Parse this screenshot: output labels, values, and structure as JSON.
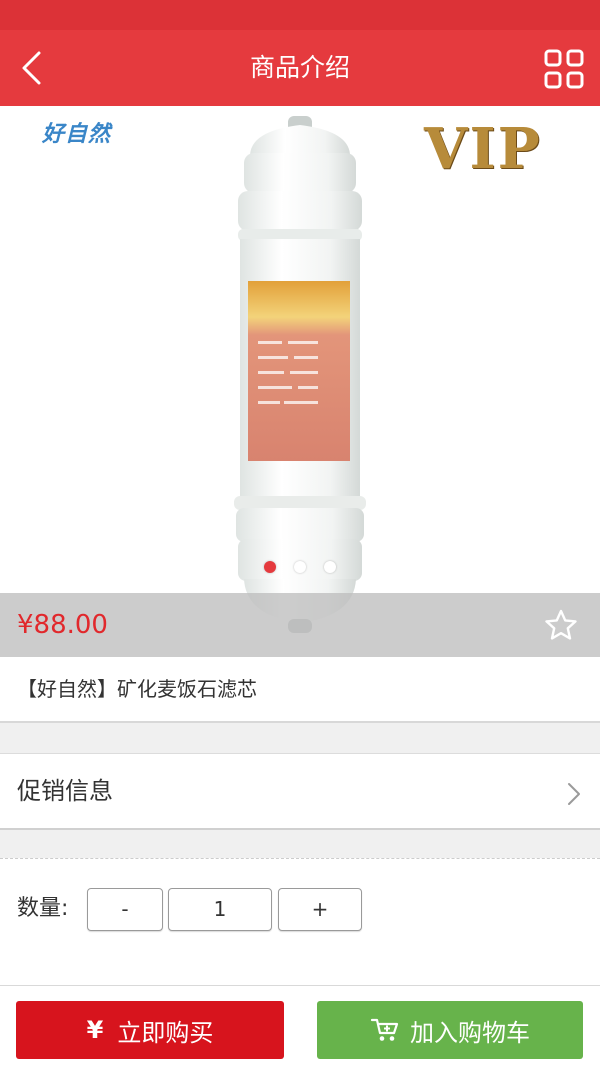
{
  "header": {
    "title": "商品介绍",
    "back_icon": "chevron-left-icon",
    "menu_icon": "grid-icon"
  },
  "hero": {
    "brand_logo_text": "好自然",
    "vip_badge_text": "VIP",
    "carousel": {
      "count": 3,
      "active_index": 0
    }
  },
  "product": {
    "price": "¥88.00",
    "title": "【好自然】矿化麦饭石滤芯",
    "favorite_icon": "star-outline-icon"
  },
  "promotion": {
    "label": "促销信息",
    "icon": "chevron-right-icon"
  },
  "quantity": {
    "label": "数量:",
    "minus_label": "-",
    "value": "1",
    "plus_label": "+"
  },
  "actions": {
    "buy_icon": "¥",
    "buy_label": "立即购买",
    "cart_icon": "cart-add-icon",
    "cart_label": "加入购物车"
  },
  "colors": {
    "header_red": "#e53a3e",
    "price_red": "#e1282c",
    "buy_red": "#d7141d",
    "cart_green": "#67b34b",
    "active_dot": "#e53a3e"
  }
}
